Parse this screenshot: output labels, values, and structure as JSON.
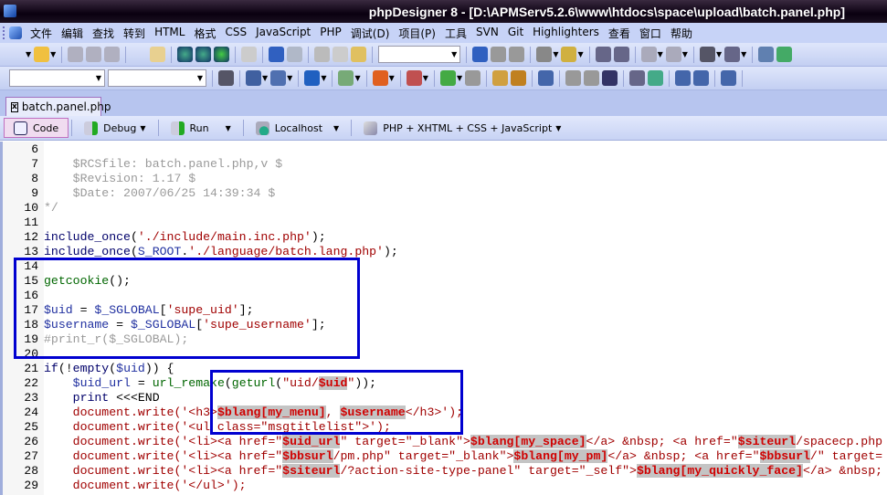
{
  "window": {
    "title": "phpDesigner 8 - [D:\\APMServ5.2.6\\www\\htdocs\\space\\upload\\batch.panel.php]"
  },
  "menu": [
    "文件",
    "编辑",
    "查找",
    "转到",
    "HTML",
    "格式",
    "CSS",
    "JavaScript",
    "PHP",
    "调试(D)",
    "项目(P)",
    "工具",
    "SVN",
    "Git",
    "Highlighters",
    "查看",
    "窗口",
    "帮助"
  ],
  "tab": {
    "label": "batch.panel.php",
    "close": "x"
  },
  "codebar": {
    "code": "Code",
    "debug": "Debug",
    "run": "Run",
    "localhost": "Localhost",
    "language": "PHP + XHTML + CSS + JavaScript"
  },
  "colors": {
    "highlight_box": "#0000d0",
    "variable_highlight": "#d00000"
  },
  "lines": [
    {
      "n": "6",
      "t": []
    },
    {
      "n": "7",
      "t": [
        [
          "c",
          "    $RCSfile: batch.panel.php,v $"
        ]
      ]
    },
    {
      "n": "8",
      "t": [
        [
          "c",
          "    $Revision: 1.17 $"
        ]
      ]
    },
    {
      "n": "9",
      "t": [
        [
          "c",
          "    $Date: 2007/06/25 14:39:34 $"
        ]
      ]
    },
    {
      "n": "10",
      "t": [
        [
          "c",
          "*/"
        ]
      ]
    },
    {
      "n": "11",
      "t": []
    },
    {
      "n": "12",
      "t": [
        [
          "k",
          "include_once"
        ],
        [
          "p",
          "("
        ],
        [
          "s",
          "'./include/main.inc.php'"
        ],
        [
          "p",
          ");"
        ]
      ]
    },
    {
      "n": "13",
      "t": [
        [
          "k",
          "include_once"
        ],
        [
          "p",
          "("
        ],
        [
          "v",
          "S_ROOT"
        ],
        [
          "p",
          "."
        ],
        [
          "s",
          "'./language/batch.lang.php'"
        ],
        [
          "p",
          ");"
        ]
      ]
    },
    {
      "n": "14",
      "t": []
    },
    {
      "n": "15",
      "t": [
        [
          "f",
          "getcookie"
        ],
        [
          "p",
          "();"
        ]
      ]
    },
    {
      "n": "16",
      "t": []
    },
    {
      "n": "17",
      "t": [
        [
          "v",
          "$uid"
        ],
        [
          "p",
          " = "
        ],
        [
          "v",
          "$_SGLOBAL"
        ],
        [
          "p",
          "["
        ],
        [
          "s",
          "'supe_uid'"
        ],
        [
          "p",
          "];"
        ]
      ]
    },
    {
      "n": "18",
      "t": [
        [
          "v",
          "$username"
        ],
        [
          "p",
          " = "
        ],
        [
          "v",
          "$_SGLOBAL"
        ],
        [
          "p",
          "["
        ],
        [
          "s",
          "'supe_username'"
        ],
        [
          "p",
          "];"
        ]
      ]
    },
    {
      "n": "19",
      "t": [
        [
          "c",
          "#print_r($_SGLOBAL);"
        ]
      ]
    },
    {
      "n": "20",
      "t": []
    },
    {
      "n": "21",
      "t": [
        [
          "k",
          "if"
        ],
        [
          "p",
          "(!"
        ],
        [
          "k",
          "empty"
        ],
        [
          "p",
          "("
        ],
        [
          "v",
          "$uid"
        ],
        [
          "p",
          ")) {"
        ]
      ]
    },
    {
      "n": "22",
      "t": [
        [
          "p",
          "    "
        ],
        [
          "v",
          "$uid_url"
        ],
        [
          "p",
          " = "
        ],
        [
          "f",
          "url_remake"
        ],
        [
          "p",
          "("
        ],
        [
          "f",
          "geturl"
        ],
        [
          "p",
          "("
        ],
        [
          "s",
          "\"uid/"
        ],
        [
          "h",
          "$uid"
        ],
        [
          "s",
          "\""
        ],
        [
          "p",
          "));"
        ]
      ]
    },
    {
      "n": "23",
      "t": [
        [
          "k",
          "    print "
        ],
        [
          "p",
          "<<<END"
        ]
      ]
    },
    {
      "n": "24",
      "t": [
        [
          "s",
          "    document.write('<h3>"
        ],
        [
          "h",
          "$blang[my_menu]"
        ],
        [
          "s",
          ", "
        ],
        [
          "h",
          "$username"
        ],
        [
          "s",
          "</h3>');"
        ]
      ]
    },
    {
      "n": "25",
      "t": [
        [
          "s",
          "    document.write('<ul class=\"msgtitlelist\">');"
        ]
      ]
    },
    {
      "n": "26",
      "t": [
        [
          "s",
          "    document.write('<li><a href=\""
        ],
        [
          "h",
          "$uid_url"
        ],
        [
          "s",
          "\" target=\"_blank\">"
        ],
        [
          "h",
          "$blang[my_space]"
        ],
        [
          "s",
          "</a> &nbsp; <a href=\""
        ],
        [
          "h",
          "$siteurl"
        ],
        [
          "s",
          "/spacecp.php"
        ]
      ]
    },
    {
      "n": "27",
      "t": [
        [
          "s",
          "    document.write('<li><a href=\""
        ],
        [
          "h",
          "$bbsurl"
        ],
        [
          "s",
          "/pm.php\" target=\"_blank\">"
        ],
        [
          "h",
          "$blang[my_pm]"
        ],
        [
          "s",
          "</a> &nbsp; <a href=\""
        ],
        [
          "h",
          "$bbsurl"
        ],
        [
          "s",
          "/\" target="
        ]
      ]
    },
    {
      "n": "28",
      "t": [
        [
          "s",
          "    document.write('<li><a href=\""
        ],
        [
          "h",
          "$siteurl"
        ],
        [
          "s",
          "/?action-site-type-panel\" target=\"_self\">"
        ],
        [
          "h",
          "$blang[my_quickly_face]"
        ],
        [
          "s",
          "</a> &nbsp;"
        ]
      ]
    },
    {
      "n": "29",
      "t": [
        [
          "s",
          "    document.write('</ul>');"
        ]
      ]
    }
  ]
}
